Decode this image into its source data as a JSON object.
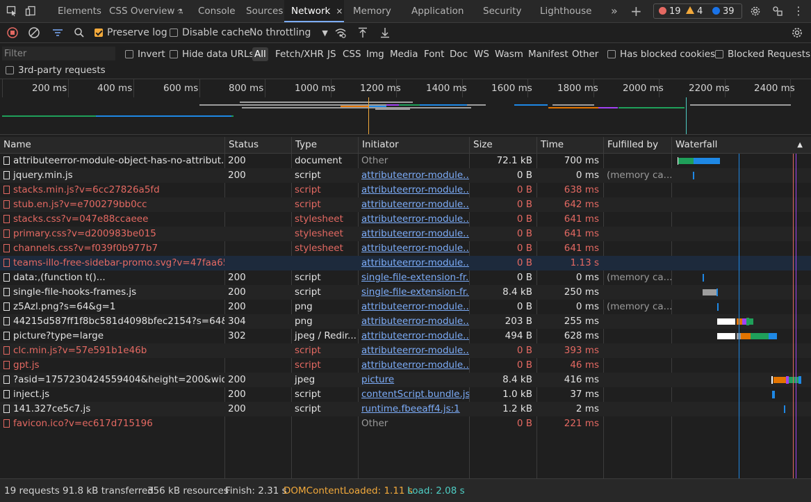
{
  "tabs": {
    "items": [
      "Elements",
      "CSS Overview",
      "Console",
      "Sources",
      "Network",
      "Memory",
      "Application",
      "Security",
      "Lighthouse"
    ],
    "active": "Network",
    "close_glyph": "×",
    "more_glyph": "»",
    "add_glyph": "+"
  },
  "issues": {
    "errors": "19",
    "warnings": "4",
    "info": "39"
  },
  "toolbar": {
    "preserve_log": "Preserve log",
    "disable_cache": "Disable cache",
    "throttling": "No throttling"
  },
  "filter": {
    "placeholder": "Filter",
    "invert": "Invert",
    "hide_data_urls": "Hide data URLs",
    "types": [
      "All",
      "Fetch/XHR",
      "JS",
      "CSS",
      "Img",
      "Media",
      "Font",
      "Doc",
      "WS",
      "Wasm",
      "Manifest",
      "Other"
    ],
    "has_blocked_cookies": "Has blocked cookies",
    "blocked_requests": "Blocked Requests",
    "third_party": "3rd-party requests"
  },
  "overview": {
    "ticks": [
      "200 ms",
      "400 ms",
      "600 ms",
      "800 ms",
      "1000 ms",
      "1200 ms",
      "1400 ms",
      "1600 ms",
      "1800 ms",
      "2000 ms",
      "2200 ms",
      "2400 ms"
    ],
    "dcl_ms": 1110,
    "load_ms": 2080
  },
  "table": {
    "columns": [
      "Name",
      "Status",
      "Type",
      "Initiator",
      "Size",
      "Time",
      "Fulfilled by",
      "Waterfall"
    ],
    "rows": [
      {
        "name": "attributeerror-module-object-has-no-attribut...",
        "status": "200",
        "type": "document",
        "initiator": "Other",
        "size": "72.1 kB",
        "time": "700 ms",
        "fulfilled": "",
        "error": false,
        "link": false,
        "wf": [
          [
            975,
            1,
            "#ffffff"
          ],
          [
            976,
            22,
            "#1fa05a"
          ],
          [
            998,
            38,
            "#1e88e5"
          ]
        ]
      },
      {
        "name": "jquery.min.js",
        "status": "200",
        "type": "script",
        "initiator": "attributeerror-module...",
        "size": "0 B",
        "time": "0 ms",
        "fulfilled": "(memory ca...",
        "error": false,
        "link": true,
        "wf": [
          [
            997,
            2,
            "#1e88e5"
          ]
        ]
      },
      {
        "name": "stacks.min.js?v=6cc27826a5fd",
        "status": "",
        "type": "script",
        "initiator": "attributeerror-module...",
        "size": "0 B",
        "time": "638 ms",
        "fulfilled": "",
        "error": true,
        "link": true,
        "wf": []
      },
      {
        "name": "stub.en.js?v=e700279bb0cc",
        "status": "",
        "type": "script",
        "initiator": "attributeerror-module...",
        "size": "0 B",
        "time": "642 ms",
        "fulfilled": "",
        "error": true,
        "link": true,
        "wf": []
      },
      {
        "name": "stacks.css?v=047e88ccaeee",
        "status": "",
        "type": "stylesheet",
        "initiator": "attributeerror-module...",
        "size": "0 B",
        "time": "641 ms",
        "fulfilled": "",
        "error": true,
        "link": true,
        "wf": []
      },
      {
        "name": "primary.css?v=d200983be015",
        "status": "",
        "type": "stylesheet",
        "initiator": "attributeerror-module...",
        "size": "0 B",
        "time": "641 ms",
        "fulfilled": "",
        "error": true,
        "link": true,
        "wf": []
      },
      {
        "name": "channels.css?v=f039f0b977b7",
        "status": "",
        "type": "stylesheet",
        "initiator": "attributeerror-module...",
        "size": "0 B",
        "time": "641 ms",
        "fulfilled": "",
        "error": true,
        "link": true,
        "wf": []
      },
      {
        "name": "teams-illo-free-sidebar-promo.svg?v=47faa65...",
        "status": "",
        "type": "",
        "initiator": "attributeerror-module...",
        "size": "0 B",
        "time": "1.13 s",
        "fulfilled": "",
        "error": true,
        "link": true,
        "wf": []
      },
      {
        "name": "data:,(function t()...",
        "status": "200",
        "type": "script",
        "initiator": "single-file-extension-fr...",
        "size": "0 B",
        "time": "0 ms",
        "fulfilled": "(memory ca...",
        "error": false,
        "link": true,
        "wf": [
          [
            1011,
            2,
            "#1e88e5"
          ]
        ]
      },
      {
        "name": "single-file-hooks-frames.js",
        "status": "200",
        "type": "script",
        "initiator": "single-file-extension-fr...",
        "size": "8.4 kB",
        "time": "250 ms",
        "fulfilled": "",
        "error": false,
        "link": true,
        "wf": [
          [
            1011,
            20,
            "#9e9e9e"
          ],
          [
            1031,
            2,
            "#1e88e5"
          ]
        ]
      },
      {
        "name": "z5Azl.png?s=64&g=1",
        "status": "200",
        "type": "png",
        "initiator": "attributeerror-module...",
        "size": "0 B",
        "time": "0 ms",
        "fulfilled": "(memory ca...",
        "error": false,
        "link": true,
        "wf": [
          [
            1032,
            2,
            "#1e88e5"
          ]
        ]
      },
      {
        "name": "44215d587ff1f8bc581d4098bfec2154?s=64&...",
        "status": "304",
        "type": "png",
        "initiator": "attributeerror-module...",
        "size": "203 B",
        "time": "255 ms",
        "fulfilled": "",
        "error": false,
        "link": true,
        "wf": [
          [
            1032,
            26,
            "#ffffff"
          ],
          [
            1060,
            8,
            "#e37400"
          ],
          [
            1068,
            6,
            "#a142f4"
          ],
          [
            1074,
            4,
            "#1fa05a"
          ],
          [
            1078,
            6,
            "#1fa05a"
          ]
        ]
      },
      {
        "name": "picture?type=large",
        "status": "302",
        "type": "jpeg / Redir...",
        "initiator": "attributeerror-module...",
        "size": "494 B",
        "time": "628 ms",
        "fulfilled": "",
        "error": false,
        "link": true,
        "wf": [
          [
            1032,
            26,
            "#ffffff"
          ],
          [
            1060,
            6,
            "#9e9e9e"
          ],
          [
            1066,
            14,
            "#e37400"
          ],
          [
            1080,
            26,
            "#1fa05a"
          ],
          [
            1106,
            12,
            "#1e88e5"
          ]
        ]
      },
      {
        "name": "clc.min.js?v=57e591b1e46b",
        "status": "",
        "type": "script",
        "initiator": "attributeerror-module...",
        "size": "0 B",
        "time": "393 ms",
        "fulfilled": "",
        "error": true,
        "link": true,
        "wf": []
      },
      {
        "name": "gpt.js",
        "status": "",
        "type": "script",
        "initiator": "attributeerror-module...",
        "size": "0 B",
        "time": "46 ms",
        "fulfilled": "",
        "error": true,
        "link": true,
        "wf": []
      },
      {
        "name": "?asid=1757230424559404&height=200&widt...",
        "status": "200",
        "type": "jpeg",
        "initiator": "picture",
        "size": "8.4 kB",
        "time": "416 ms",
        "fulfilled": "",
        "error": false,
        "link": true,
        "wf": [
          [
            1110,
            2,
            "#ffffff"
          ],
          [
            1113,
            18,
            "#e37400"
          ],
          [
            1131,
            4,
            "#a142f4"
          ],
          [
            1135,
            14,
            "#1fa05a"
          ],
          [
            1149,
            4,
            "#1e88e5"
          ]
        ]
      },
      {
        "name": "inject.js",
        "status": "200",
        "type": "script",
        "initiator": "contentScript.bundle.js...",
        "size": "1.0 kB",
        "time": "37 ms",
        "fulfilled": "",
        "error": false,
        "link": true,
        "wf": [
          [
            1111,
            4,
            "#1e88e5"
          ]
        ]
      },
      {
        "name": "141.327ce5c7.js",
        "status": "200",
        "type": "script",
        "initiator": "runtime.fbeeaff4.js:1",
        "size": "1.2 kB",
        "time": "2 ms",
        "fulfilled": "",
        "error": false,
        "link": true,
        "wf": [
          [
            1128,
            2,
            "#1e88e5"
          ]
        ]
      },
      {
        "name": "favicon.ico?v=ec617d715196",
        "status": "",
        "type": "",
        "initiator": "Other",
        "size": "0 B",
        "time": "221 ms",
        "fulfilled": "",
        "error": true,
        "link": false,
        "wf": []
      }
    ]
  },
  "status": {
    "requests": "19 requests",
    "transferred": "91.8 kB transferred",
    "resources": "356 kB resources",
    "finish": "Finish: 2.31 s",
    "dcl": "DOMContentLoaded: 1.11 s",
    "load": "Load: 2.08 s",
    "dcl_color": "#f2a93b",
    "load_color": "#4ecdc4"
  }
}
